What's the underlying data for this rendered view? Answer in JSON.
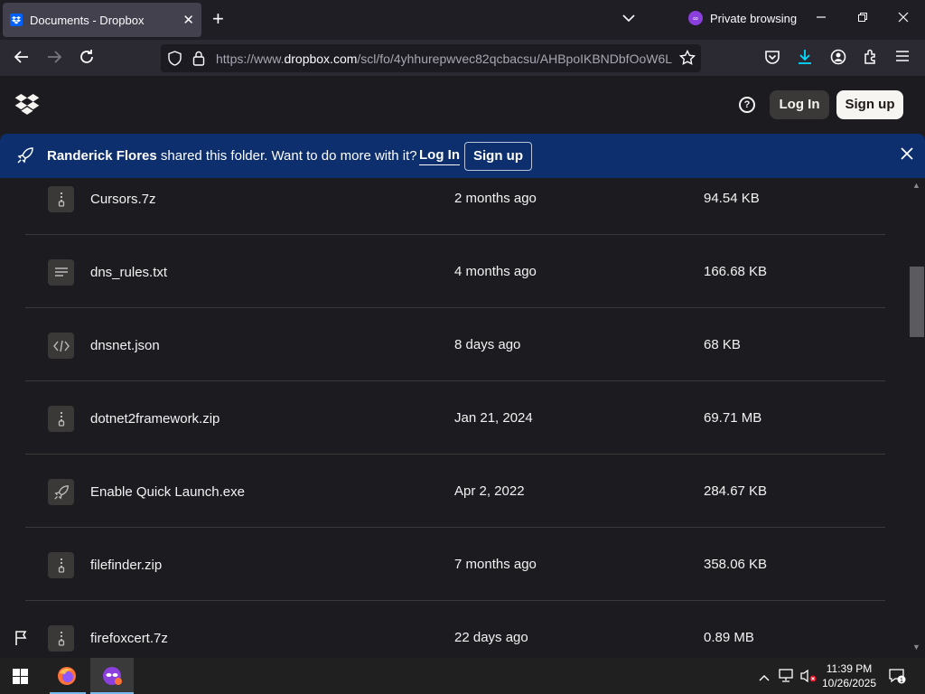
{
  "browser": {
    "tab_title": "Documents - Dropbox",
    "tab_close": "✕",
    "new_tab": "+",
    "private_label": "Private browsing",
    "url_prefix": "https://www.",
    "url_host": "dropbox.com",
    "url_path": "/scl/fo/4yhhurepwvec82qcbacsu/AHBpoIKBNDbfOoW6L"
  },
  "header": {
    "help": "?",
    "login": "Log In",
    "signup": "Sign up"
  },
  "banner": {
    "sharer": "Randerick Flores",
    "message": " shared this folder. Want to do more with it?",
    "login": "Log In",
    "signup": "Sign up"
  },
  "files": [
    {
      "name": "Cursors.7z",
      "modified": "2 months ago",
      "size": "94.54 KB",
      "icon": "zip-icon"
    },
    {
      "name": "dns_rules.txt",
      "modified": "4 months ago",
      "size": "166.68 KB",
      "icon": "text-file-icon"
    },
    {
      "name": "dnsnet.json",
      "modified": "8 days ago",
      "size": "68 KB",
      "icon": "code-file-icon"
    },
    {
      "name": "dotnet2framework.zip",
      "modified": "Jan 21, 2024",
      "size": "69.71 MB",
      "icon": "zip-icon"
    },
    {
      "name": "Enable Quick Launch.exe",
      "modified": "Apr 2, 2022",
      "size": "284.67 KB",
      "icon": "executable-icon"
    },
    {
      "name": "filefinder.zip",
      "modified": "7 months ago",
      "size": "358.06 KB",
      "icon": "zip-icon"
    },
    {
      "name": "firefoxcert.7z",
      "modified": "22 days ago",
      "size": "0.89 MB",
      "icon": "zip-icon"
    }
  ],
  "taskbar": {
    "time": "11:39 PM",
    "date": "10/26/2025",
    "notification_count": "1"
  },
  "colors": {
    "banner_bg": "#0d2f6d",
    "page_bg": "#1c1b1f",
    "dropbox_blue": "#0061fe"
  }
}
